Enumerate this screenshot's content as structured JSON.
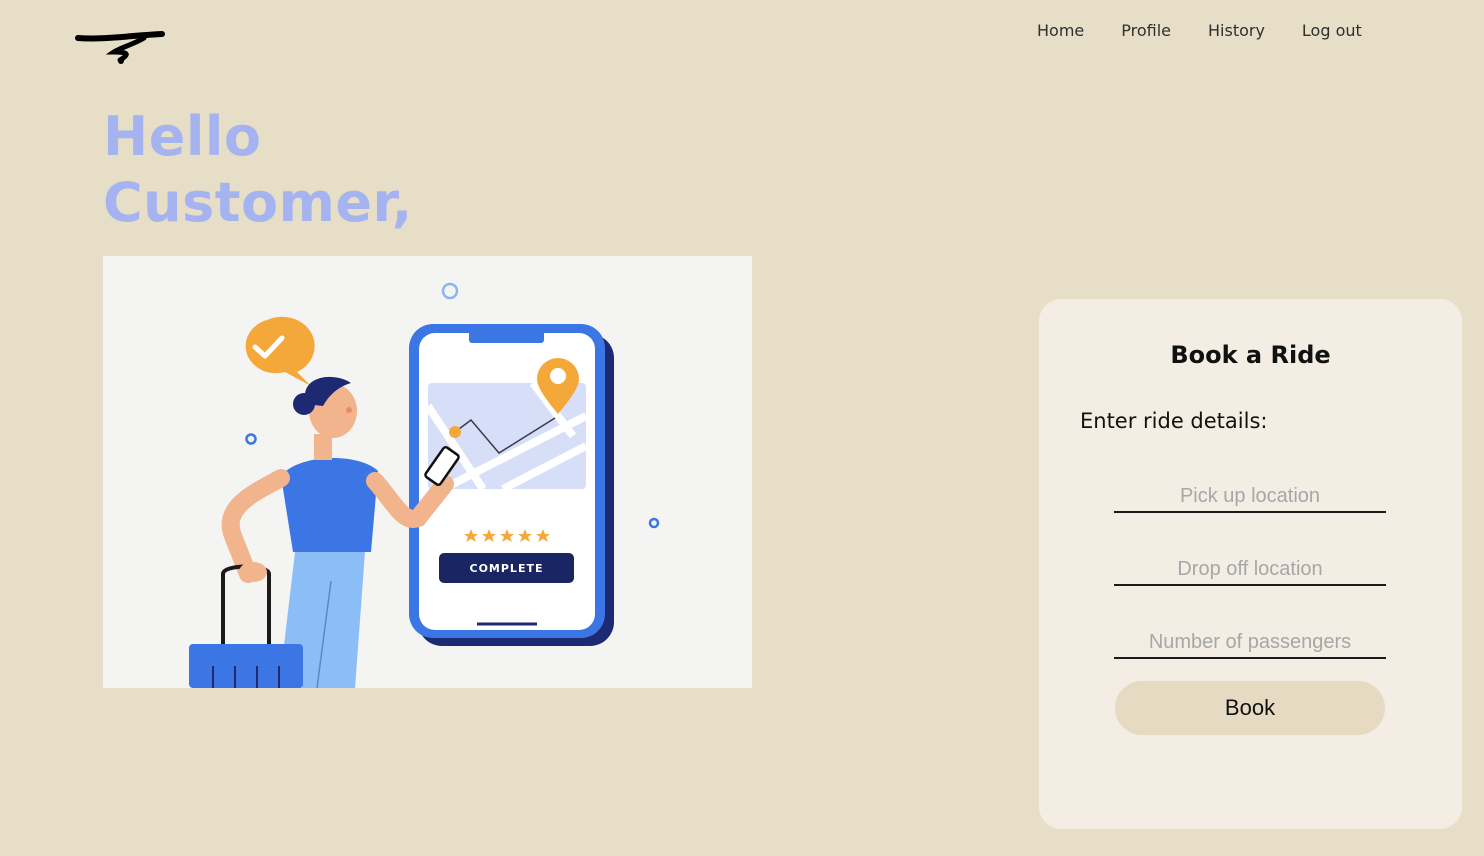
{
  "nav": {
    "items": [
      {
        "label": "Home"
      },
      {
        "label": "Profile"
      },
      {
        "label": "History"
      },
      {
        "label": "Log out"
      }
    ]
  },
  "greeting": {
    "line1": "Hello",
    "line2": "Customer,"
  },
  "illustration": {
    "button_label": "COMPLETE",
    "rating_stars": 5
  },
  "booking": {
    "title": "Book a Ride",
    "subtitle": "Enter ride details:",
    "pickup_placeholder": "Pick up location",
    "dropoff_placeholder": "Drop off location",
    "passengers_placeholder": "Number of passengers",
    "submit_label": "Book"
  },
  "colors": {
    "background": "#e6dec7",
    "greeting": "#a5b4f0",
    "card": "#f3ede3",
    "button": "#e6dac3",
    "accent_blue": "#3b76e4",
    "accent_orange": "#f5a83a"
  }
}
